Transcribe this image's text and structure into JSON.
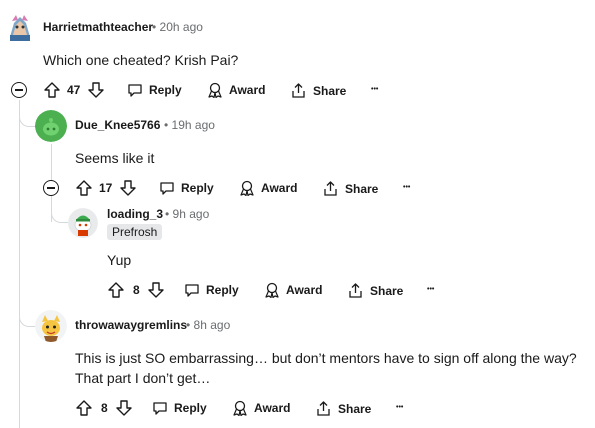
{
  "comments": [
    {
      "username": "Harrietmathteacher",
      "time": "20h ago",
      "body": "Which one cheated? Krish Pai?",
      "votes": "47",
      "reply": "Reply",
      "award": "Award",
      "share": "Share"
    },
    {
      "username": "Due_Knee5766",
      "time": "19h ago",
      "body": "Seems like it",
      "votes": "17",
      "reply": "Reply",
      "award": "Award",
      "share": "Share"
    },
    {
      "username": "loading_3",
      "time": "9h ago",
      "flair": "Prefrosh",
      "body": "Yup",
      "votes": "8",
      "reply": "Reply",
      "award": "Award",
      "share": "Share"
    },
    {
      "username": "throwawaygremlins",
      "time": "8h ago",
      "body": "This is just SO embarrassing… but don’t mentors have to sign off along the way? That part I don’t get…",
      "votes": "8",
      "reply": "Reply",
      "award": "Award",
      "share": "Share"
    }
  ],
  "separator": "•",
  "more": "•••"
}
